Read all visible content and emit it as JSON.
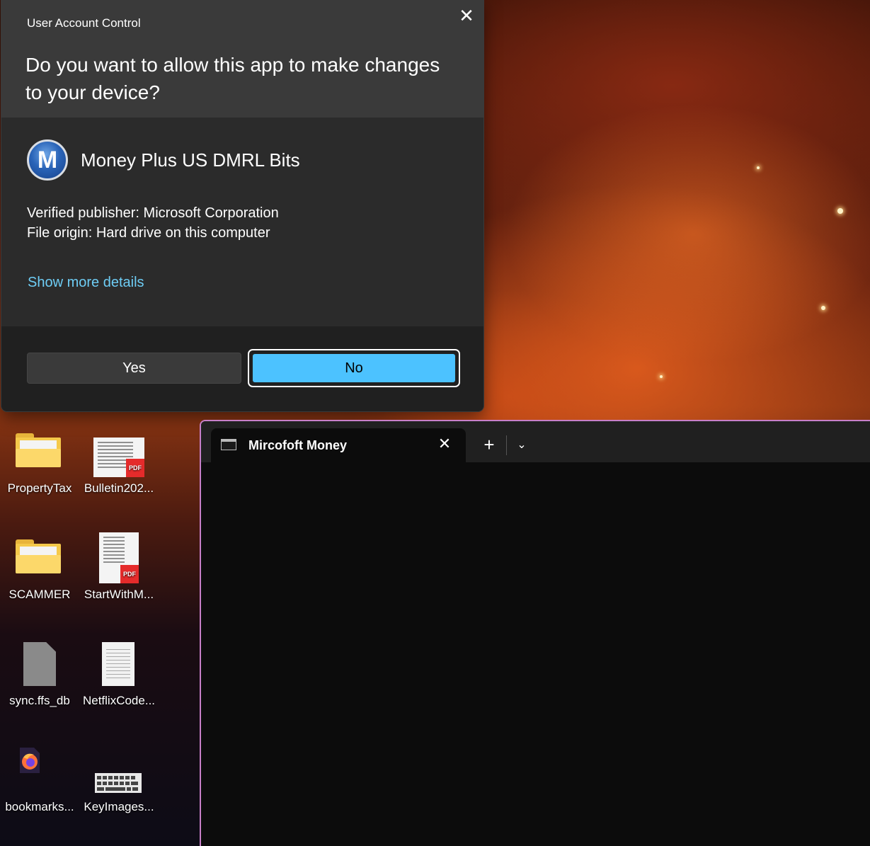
{
  "uac": {
    "window_title": "User Account Control",
    "question": "Do you want to allow this app to make changes to your device?",
    "app_logo_letter": "M",
    "app_name": "Money Plus US DMRL Bits",
    "publisher": "Verified publisher: Microsoft Corporation",
    "file_origin": "File origin: Hard drive on this computer",
    "more_details_link": "Show more details",
    "yes_label": "Yes",
    "no_label": "No",
    "close_glyph": "✕",
    "accent_color": "#4cc2ff",
    "link_color": "#6ecdf5"
  },
  "desktop": {
    "icons": [
      {
        "label": "PropertyTax",
        "type": "folder"
      },
      {
        "label": "Bulletin202...",
        "type": "pdf"
      },
      {
        "label": "SCAMMER",
        "type": "folder"
      },
      {
        "label": "StartWithM...",
        "type": "pdf"
      },
      {
        "label": "sync.ffs_db",
        "type": "file"
      },
      {
        "label": "NetflixCode...",
        "type": "text-document"
      },
      {
        "label": "bookmarks...",
        "type": "firefox-html"
      },
      {
        "label": "KeyImages...",
        "type": "image"
      }
    ],
    "pdf_badge": "PDF"
  },
  "terminal": {
    "tab_title": "Mircofoft Money",
    "tab_close_glyph": "✕",
    "new_tab_glyph": "+",
    "dropdown_glyph": "⌄",
    "border_color": "#c77fc8"
  }
}
